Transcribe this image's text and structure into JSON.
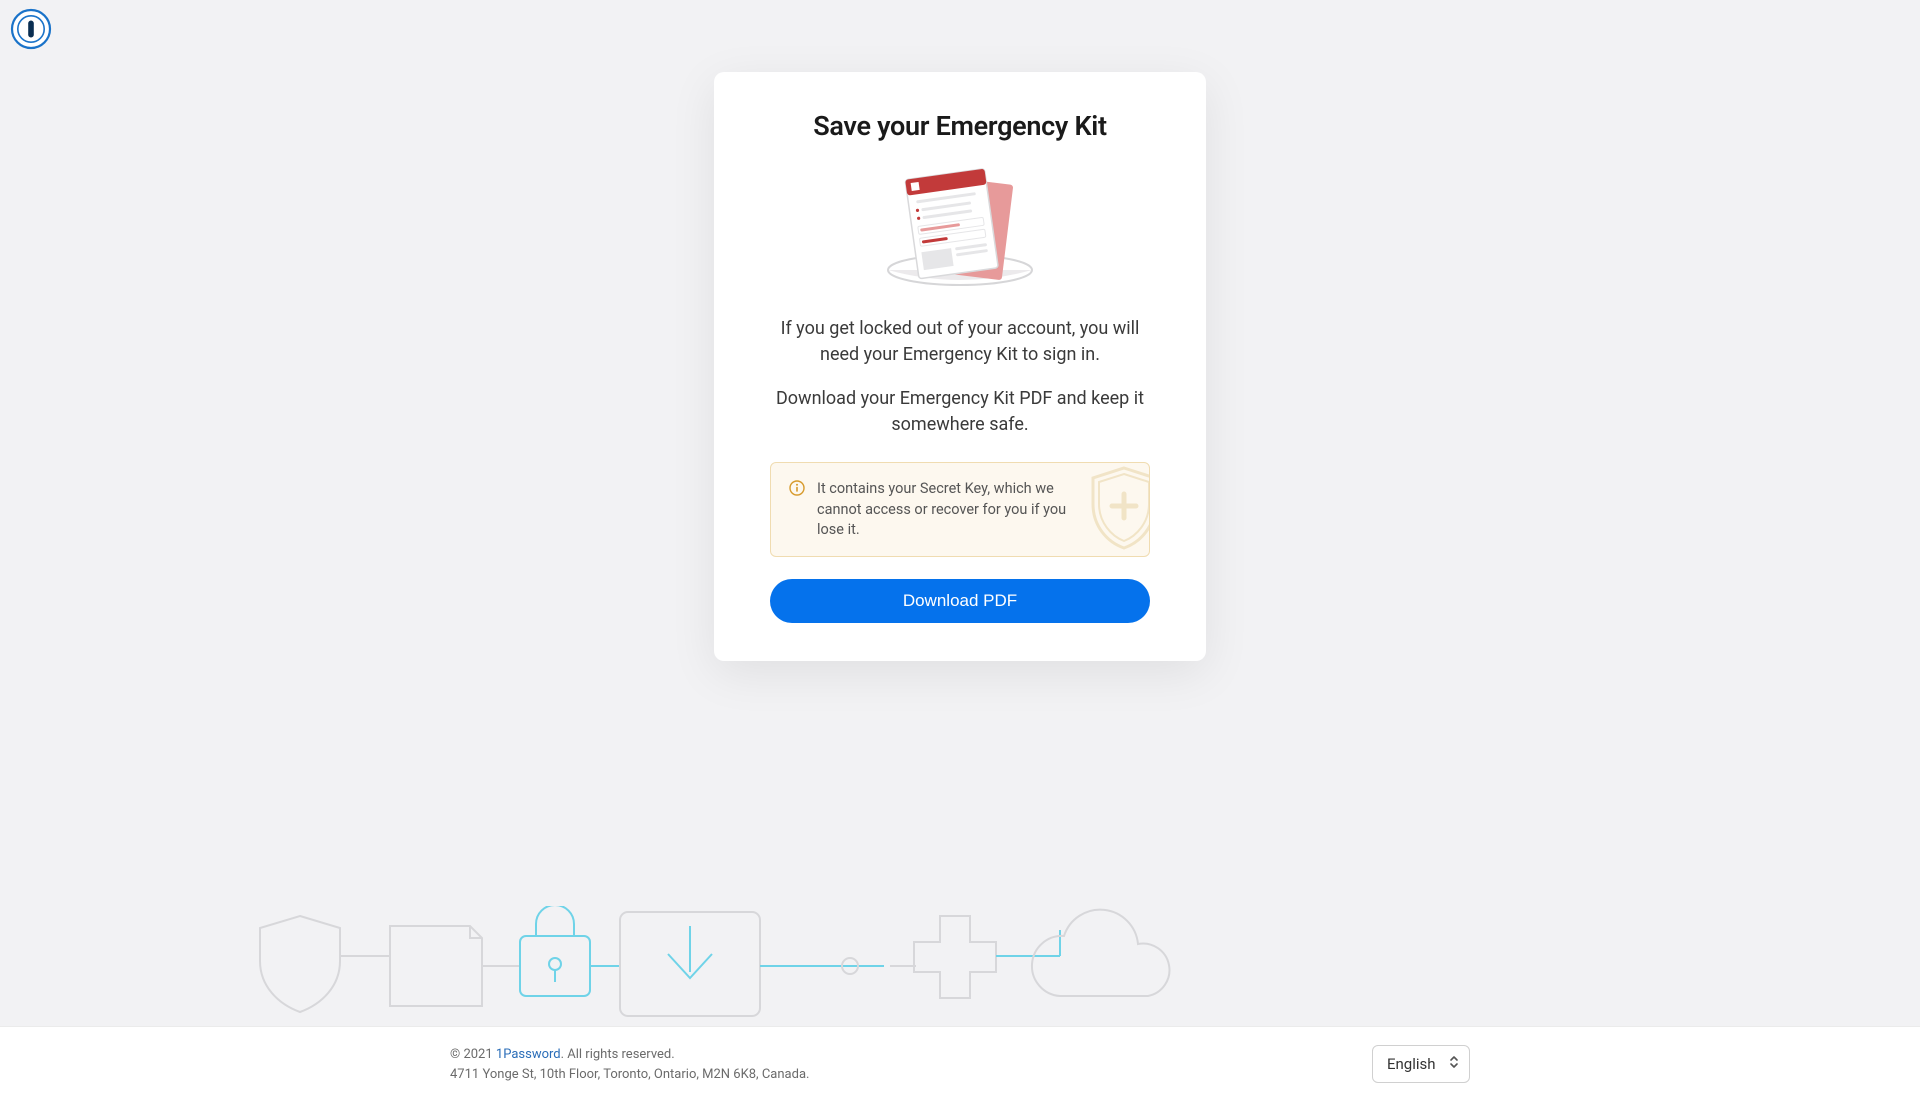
{
  "heading": "Save your Emergency Kit",
  "paragraph1": "If you get locked out of your account, you will need your Emergency Kit to sign in.",
  "paragraph2": "Download your Emergency Kit PDF and keep it somewhere safe.",
  "info_text": "It contains your Secret Key, which we cannot access or recover for you if you lose it.",
  "download_label": "Download PDF",
  "footer": {
    "copyright_prefix": "© 2021 ",
    "brand_link": "1Password",
    "copyright_suffix": ". All rights reserved.",
    "address": "4711 Yonge St, 10th Floor, Toronto, Ontario, M2N 6K8, Canada."
  },
  "language": "English"
}
